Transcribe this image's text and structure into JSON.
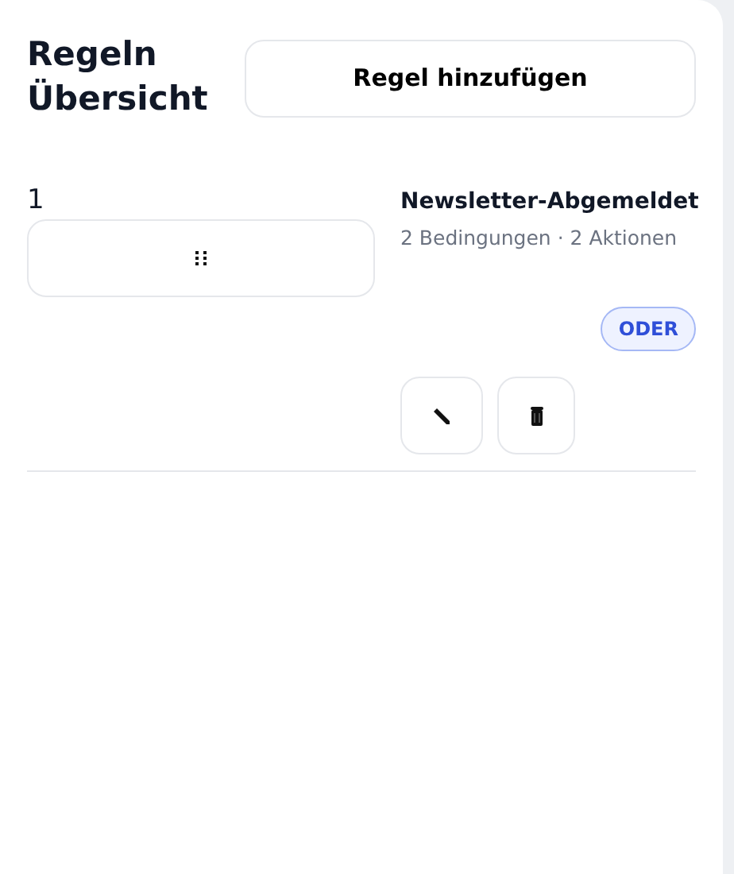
{
  "title": "Regeln Übersicht",
  "add_button": "Regel hinzufügen",
  "rules": [
    {
      "number": "1",
      "name": "Newsletter-Abgemeldet",
      "summary": "2 Bedingungen · 2 Aktionen",
      "logic": "ODER"
    }
  ]
}
